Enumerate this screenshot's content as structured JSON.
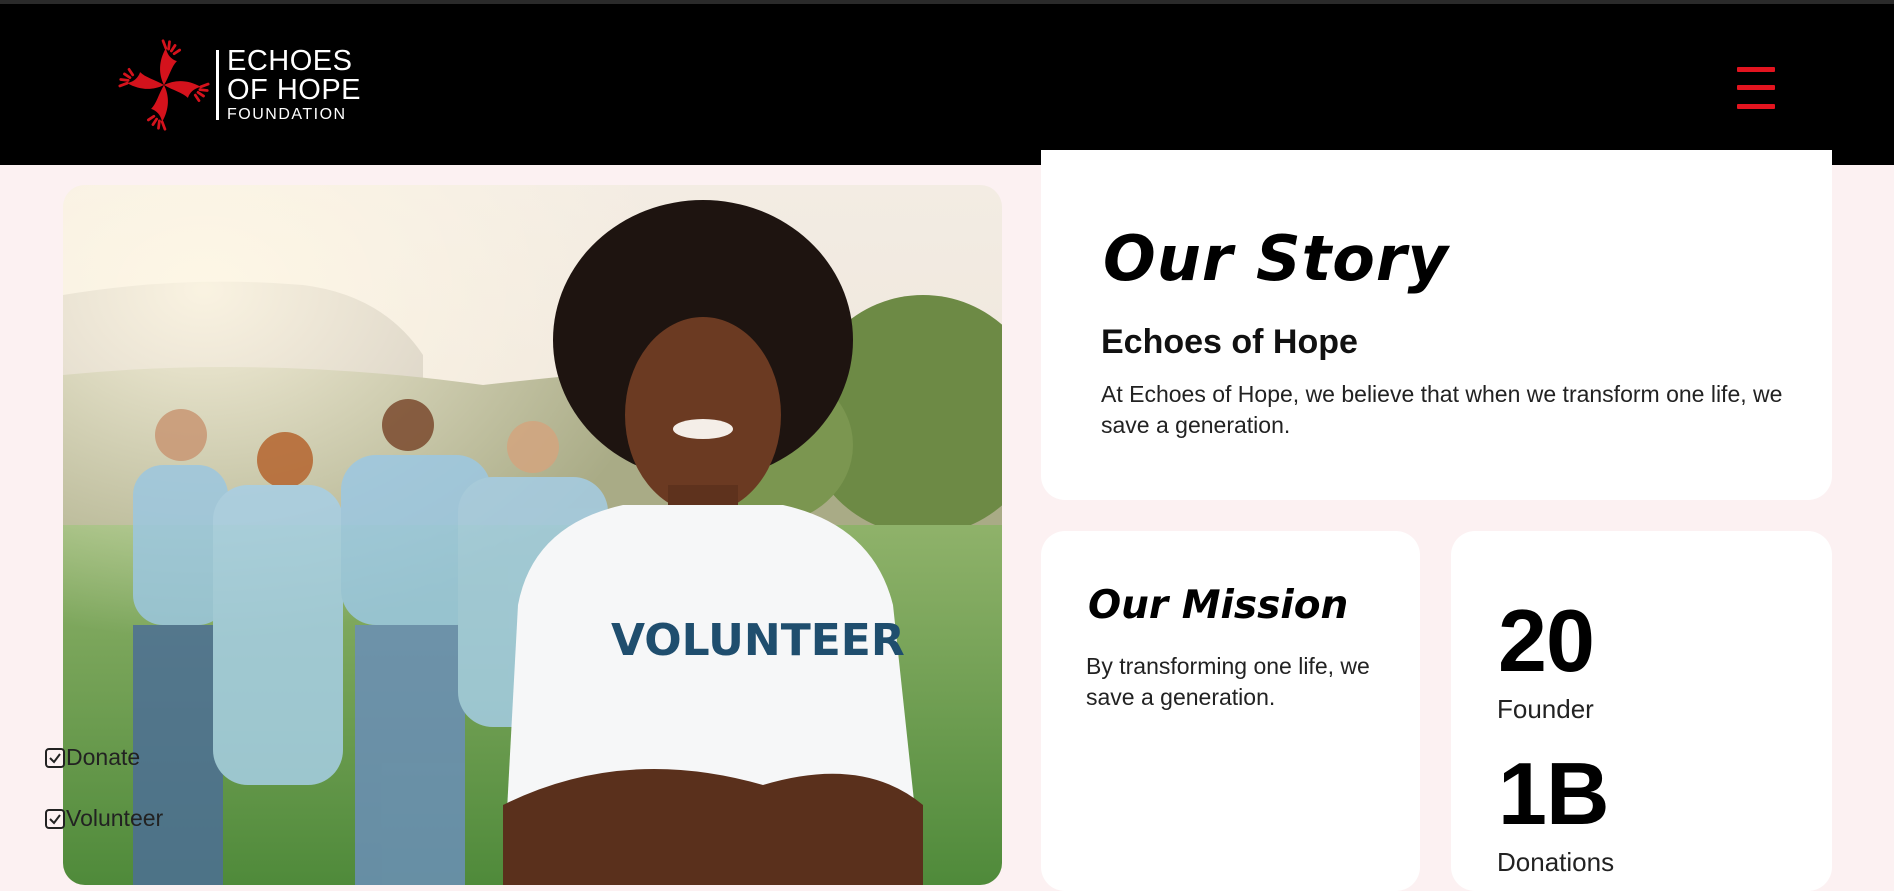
{
  "colors": {
    "header_bg": "#000000",
    "accent": "#e3141f",
    "page_bg": "#fcf1f2",
    "card_bg": "#ffffff"
  },
  "header": {
    "logo": {
      "line1": "ECHOES",
      "line2": "OF HOPE",
      "line3": "FOUNDATION",
      "icon": "hands-pinwheel-icon"
    },
    "menu_icon": "hamburger-menu-icon"
  },
  "hero": {
    "image": "smiling-volunteer-photo",
    "shirt_text": "VOLUNTEER"
  },
  "story": {
    "title": "Our Story",
    "subtitle": "Echoes of Hope",
    "text": "At Echoes of Hope, we believe that when we transform one life, we save a generation."
  },
  "mission": {
    "title": "Our Mission",
    "text": "By transforming one life, we save a generation.",
    "items": [
      {
        "label": "Donate",
        "icon": "checkbox-checked-icon"
      },
      {
        "label": "Volunteer",
        "icon": "checkbox-checked-icon"
      }
    ]
  },
  "stats": [
    {
      "value": "20",
      "label": "Founder"
    },
    {
      "value": "1B",
      "label": "Donations"
    }
  ]
}
